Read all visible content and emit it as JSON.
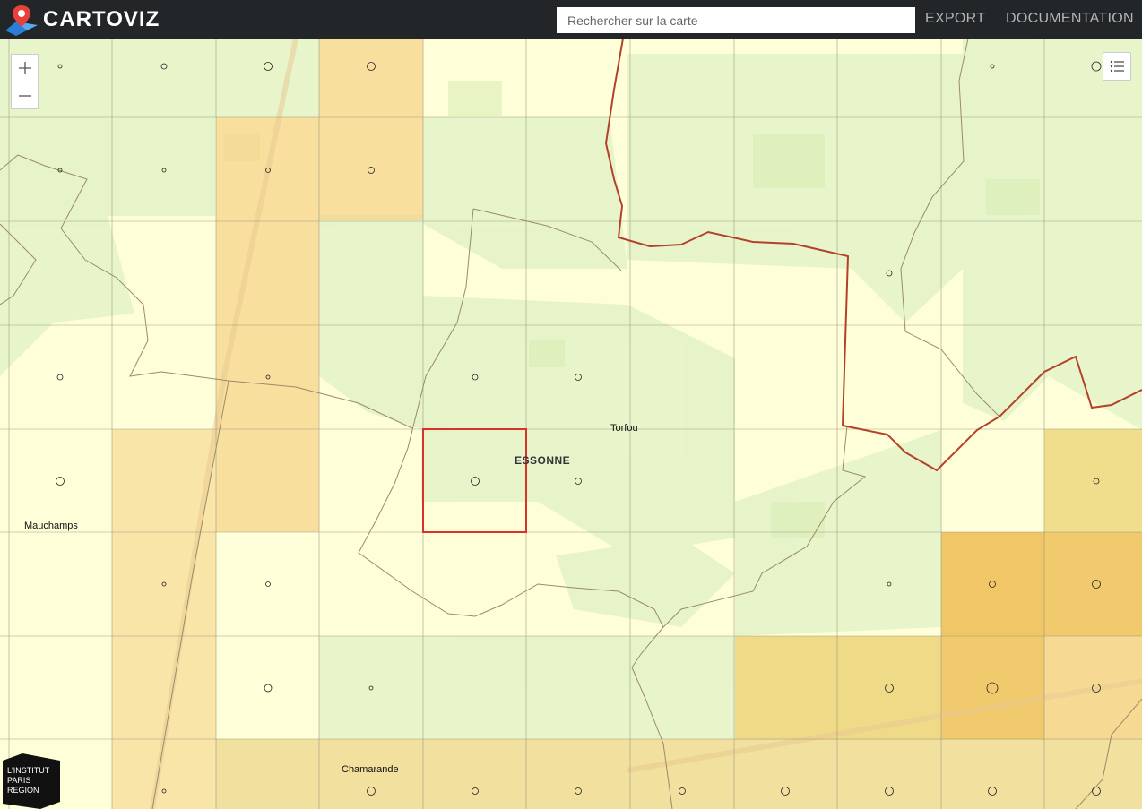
{
  "app": {
    "name": "CARTOVIZ"
  },
  "search": {
    "placeholder": "Rechercher sur la carte"
  },
  "nav": {
    "export_label": "EXPORT",
    "documentation_label": "DOCUMENTATION"
  },
  "map": {
    "places": {
      "torfou": "Torfou",
      "essonne": "ESSONNE",
      "mauchamps": "Mauchamps",
      "chamarande": "Chamarande"
    },
    "selected_color": "#d8322a",
    "boundary_color": "#b3412a"
  },
  "ipr_logo": {
    "line1": "L'INSTITUT",
    "line2": "PARIS",
    "line3": "REGION"
  }
}
